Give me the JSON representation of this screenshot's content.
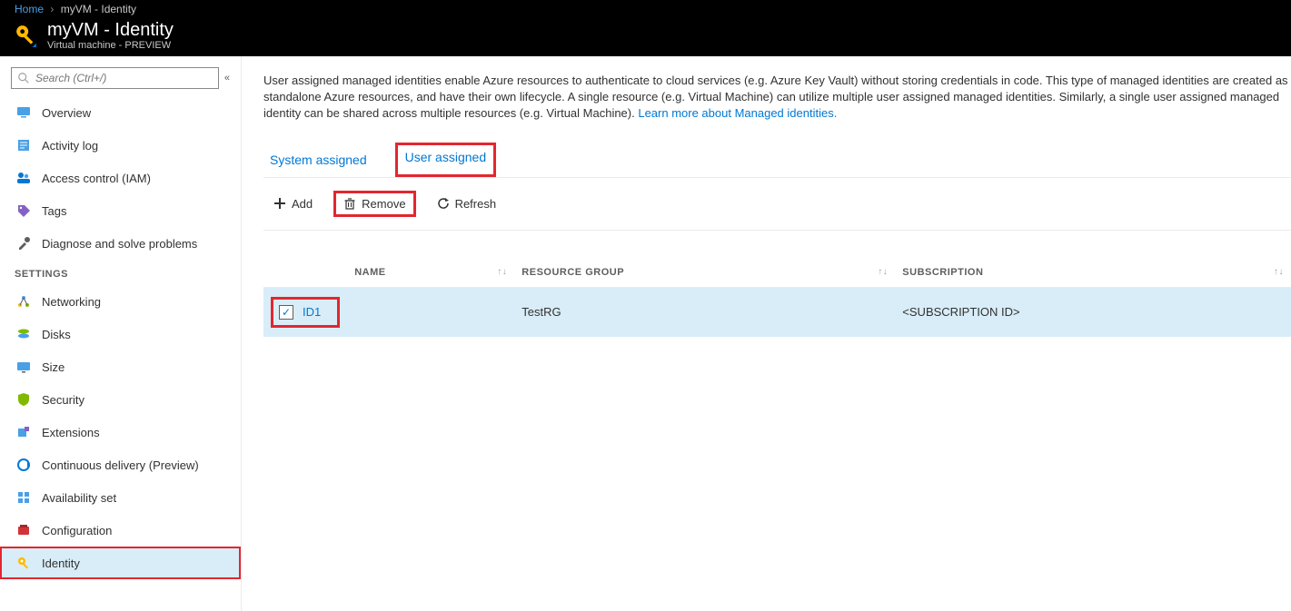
{
  "breadcrumb": {
    "home": "Home",
    "current": "myVM - Identity"
  },
  "header": {
    "title": "myVM - Identity",
    "subtitle": "Virtual machine - PREVIEW"
  },
  "search": {
    "placeholder": "Search (Ctrl+/)"
  },
  "sidebar": {
    "general": [
      {
        "label": "Overview",
        "icon": "monitor"
      },
      {
        "label": "Activity log",
        "icon": "log"
      },
      {
        "label": "Access control (IAM)",
        "icon": "iam"
      },
      {
        "label": "Tags",
        "icon": "tag"
      },
      {
        "label": "Diagnose and solve problems",
        "icon": "wrench"
      }
    ],
    "settings_label": "SETTINGS",
    "settings": [
      {
        "label": "Networking",
        "icon": "network"
      },
      {
        "label": "Disks",
        "icon": "disks"
      },
      {
        "label": "Size",
        "icon": "size"
      },
      {
        "label": "Security",
        "icon": "shield"
      },
      {
        "label": "Extensions",
        "icon": "ext"
      },
      {
        "label": "Continuous delivery (Preview)",
        "icon": "cd"
      },
      {
        "label": "Availability set",
        "icon": "avail"
      },
      {
        "label": "Configuration",
        "icon": "config"
      },
      {
        "label": "Identity",
        "icon": "identity",
        "active": true,
        "highlighted": true
      }
    ]
  },
  "content": {
    "description": "User assigned managed identities enable Azure resources to authenticate to cloud services (e.g. Azure Key Vault) without storing credentials in code. This type of managed identities are created as standalone Azure resources, and have their own lifecycle. A single resource (e.g. Virtual Machine) can utilize multiple user assigned managed identities. Similarly, a single user assigned managed identity can be shared across multiple resources (e.g. Virtual Machine). ",
    "learn_more": "Learn more about Managed identities.",
    "tabs": {
      "system": "System assigned",
      "user": "User assigned"
    },
    "toolbar": {
      "add": "Add",
      "remove": "Remove",
      "refresh": "Refresh"
    },
    "table": {
      "headers": {
        "name": "NAME",
        "rg": "RESOURCE GROUP",
        "sub": "SUBSCRIPTION"
      },
      "rows": [
        {
          "name": "ID1",
          "rg": "TestRG",
          "sub": "<SUBSCRIPTION ID>",
          "checked": true
        }
      ]
    }
  }
}
